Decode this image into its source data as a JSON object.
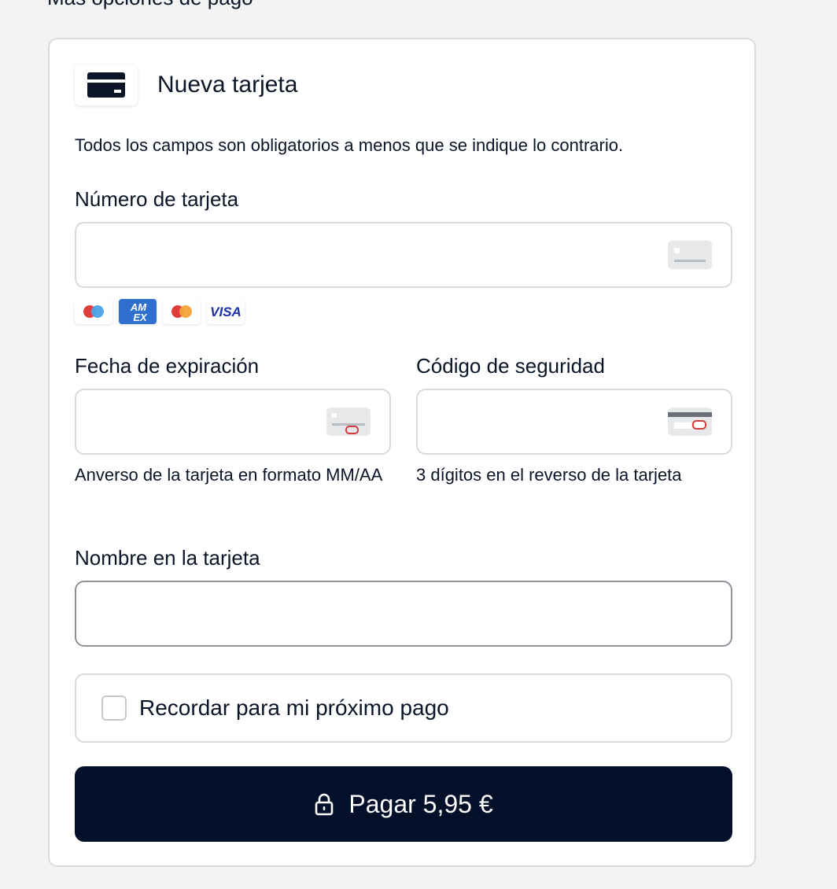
{
  "section": {
    "heading": "Más opciones de pago"
  },
  "method": {
    "title": "Nueva tarjeta",
    "icon": "credit-card-icon"
  },
  "form": {
    "required_note": "Todos los campos son obligatorios a menos que se indique lo contrario.",
    "card_number": {
      "label": "Número de tarjeta",
      "value": "",
      "icon": "card-front-icon"
    },
    "card_brands": [
      "Maestro",
      "American Express",
      "Mastercard",
      "VISA"
    ],
    "expiry": {
      "label": "Fecha de expiración",
      "value": "",
      "hint": "Anverso de la tarjeta en formato MM/AA",
      "icon": "card-expiry-icon"
    },
    "security_code": {
      "label": "Código de seguridad",
      "value": "",
      "hint": "3 dígitos en el reverso de la tarjeta",
      "icon": "card-back-cvv-icon"
    },
    "name_on_card": {
      "label": "Nombre en la tarjeta",
      "value": ""
    },
    "remember": {
      "label": "Recordar para mi próximo pago",
      "checked": false
    },
    "pay_button": {
      "label": "Pagar 5,95 €",
      "icon": "lock-icon"
    }
  },
  "colors": {
    "background": "#f3f3f3",
    "text": "#0b1528",
    "border": "#d8dadf",
    "button": "#03102a",
    "amex": "#2f6fd0",
    "visa": "#1a2fa8",
    "cvv_highlight": "#d23c3c"
  }
}
